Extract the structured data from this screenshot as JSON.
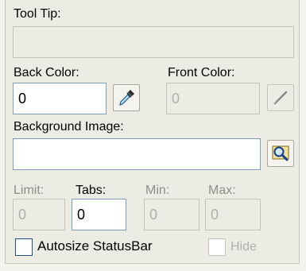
{
  "tooltip": {
    "label": "Tool Tip:",
    "value": ""
  },
  "back_color": {
    "label": "Back Color:",
    "value": "0"
  },
  "front_color": {
    "label": "Front Color:",
    "value": "0"
  },
  "background_image": {
    "label": "Background Image:",
    "value": ""
  },
  "limit": {
    "label": "Limit:",
    "value": "0"
  },
  "tabs": {
    "label": "Tabs:",
    "value": "0"
  },
  "min": {
    "label": "Min:",
    "value": "0"
  },
  "max": {
    "label": "Max:",
    "value": "0"
  },
  "autosize": {
    "label": "Autosize StatusBar",
    "checked": false
  },
  "hide": {
    "label": "Hide",
    "checked": false
  },
  "icons": {
    "back_color_picker": "eyedropper-icon",
    "front_color_picker": "pencil-icon",
    "background_image_browse": "magnifier-icon"
  }
}
